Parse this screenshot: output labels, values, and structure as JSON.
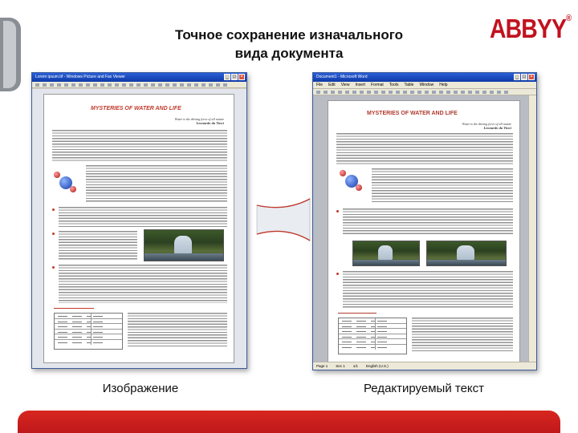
{
  "slide": {
    "title_line1": "Точное сохранение изначального",
    "title_line2": "вида документа",
    "logo_text": "ABBYY",
    "logo_reg": "®",
    "caption_left": "Изображение",
    "caption_right": "Редактируемый текст",
    "accent_color": "#c1121f"
  },
  "left_window": {
    "title": "Lorem ipsum.tif - Windows Picture and Fax Viewer",
    "buttons": {
      "minimize": "_",
      "maximize": "□",
      "close": "×"
    },
    "doc_title": "MYSTERIES OF WATER AND LIFE",
    "epigraph": "Water is the driving force of all nature",
    "epigraph_author": "Leonardo da Vinci"
  },
  "right_window": {
    "title": "Document1 - Microsoft Word",
    "menu": [
      "File",
      "Edit",
      "View",
      "Insert",
      "Format",
      "Tools",
      "Table",
      "Window",
      "Help"
    ],
    "buttons": {
      "minimize": "_",
      "maximize": "□",
      "close": "×"
    },
    "doc_title": "MYSTERIES OF WATER AND LIFE",
    "epigraph": "Water is the driving force of all nature",
    "epigraph_author": "Leonardo da Vinci",
    "status": {
      "page": "Page 1",
      "sec": "Sec 1",
      "pages": "1/1",
      "lang": "English (U.S.)"
    }
  }
}
